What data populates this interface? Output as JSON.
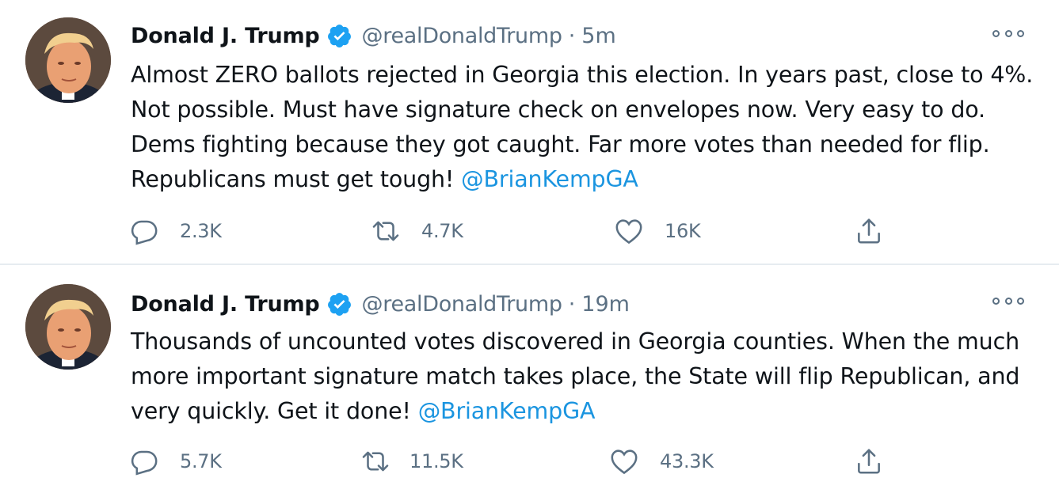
{
  "colors": {
    "text": "#0f1419",
    "secondary": "#5b7083",
    "link": "#1b95e0",
    "verified": "#1da1f2",
    "divider": "#e6ecf0"
  },
  "icons": {
    "verified": "verified-badge-icon",
    "more": "more-options-icon",
    "reply": "reply-icon",
    "retweet": "retweet-icon",
    "like": "heart-icon",
    "share": "share-icon"
  },
  "tweets": [
    {
      "author": {
        "name": "Donald J. Trump",
        "handle": "@realDonaldTrump"
      },
      "time": "5m",
      "text": "Almost ZERO ballots rejected in Georgia this election. In years past, close to 4%. Not possible. Must have signature check on envelopes now. Very easy to do. Dems fighting because they got caught. Far more votes than needed for flip. Republicans must get tough! ",
      "mention": "@BrianKempGA",
      "stats": {
        "replies": "2.3K",
        "retweets": "4.7K",
        "likes": "16K"
      }
    },
    {
      "author": {
        "name": "Donald J. Trump",
        "handle": "@realDonaldTrump"
      },
      "time": "19m",
      "text": "Thousands of uncounted votes discovered in Georgia counties. When the much more important signature match takes place, the State will flip Republican, and very quickly. Get it done! ",
      "mention": "@BrianKempGA",
      "stats": {
        "replies": "5.7K",
        "retweets": "11.5K",
        "likes": "43.3K"
      }
    }
  ],
  "separator": "·"
}
